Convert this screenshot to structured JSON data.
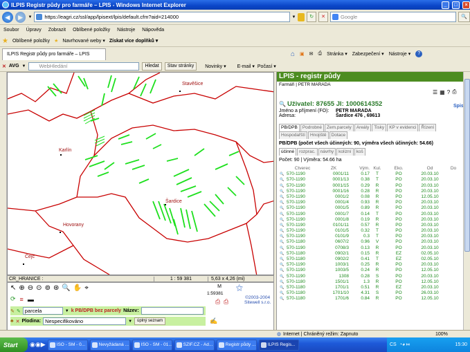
{
  "window": {
    "title": "ILPIS Registr půdy pro farmáře – LPIS - Windows Internet Explorer"
  },
  "address": {
    "url": "https://eagri.cz/ssl/app/lpisext/lpis/default.cfm?aid=214000",
    "search_placeholder": "Google"
  },
  "menu": [
    "Soubor",
    "Úpravy",
    "Zobrazit",
    "Oblíbené položky",
    "Nástroje",
    "Nápověda"
  ],
  "favbar": {
    "favorites": "Oblíbené položky",
    "suggested": "Navrhované weby ▾",
    "more": "Získat více doplňků ▾"
  },
  "tab": {
    "label": "ILPIS Registr půdy pro farmáře – LPIS"
  },
  "cmdbar": {
    "page": "Stránka ▾",
    "security": "Zabezpečení ▾",
    "tools": "Nástroje ▾"
  },
  "avg": {
    "label": "AVG",
    "search_placeholder": "WebHledání",
    "search_btn": "Hledat",
    "status_btn": "Stav stránky",
    "news": "Novinky ▾",
    "email": "E-mail ▾",
    "weather": "Počasí ▾"
  },
  "map": {
    "places": [
      "Stavěšice",
      "Karlín",
      "Šardice",
      "Hovorany",
      "Čejč"
    ],
    "label_left": "CR_HRANICE :",
    "scale": "1 : 59 381",
    "extent": "5,63 x 4,26 (mi)",
    "scale_small": "1:59381",
    "m_label": "M",
    "copyright1": "©2003-2004",
    "copyright2": "Sitewell s.r.o.",
    "layer_select": "parcela",
    "pb_label": "k PB/DPB bez parcely",
    "name_label": "Název:",
    "plodina_label": "Plodina:",
    "plodina_value": "Nespecifikováno",
    "full_list": "úplný seznam"
  },
  "panel": {
    "header": "LPIS - registr půdy",
    "sub": "Farmáři | PETR MARADA",
    "user": "Uživatel: 87655 JI: 1000614352",
    "spis": "Spis",
    "jmeno_label": "Jméno a příjmení (FO):",
    "jmeno": "PETR MARADA",
    "adresa_label": "Adresa:",
    "adresa": "Šardice 476 , 69613",
    "tabs1": [
      "PB/DPB",
      "Podrobné",
      "Zem.parcely",
      "Areály",
      "Tisky",
      "KP v evidenci",
      "Řízení"
    ],
    "tabs2": [
      "Hospodařští",
      "Hnojiště",
      "Dotace"
    ],
    "summary": "PB/DPB (počet všech účinných: 90, výměra všech účinných: 54.66)",
    "subtabs": [
      "účinné",
      "rozprac.",
      "návrhy",
      "kolizní",
      "koš"
    ],
    "count": "Počet: 90 | Výměra: 54.66 ha",
    "columns": [
      "Čtverec",
      "ZK",
      "Vým.",
      "Kul.",
      "Eko.",
      "Od",
      "Do"
    ],
    "rows": [
      [
        "570-1190",
        "0001/11",
        "0.17",
        "T",
        "PO",
        "20.03.10"
      ],
      [
        "570-1190",
        "0001/13",
        "0.38",
        "T",
        "PO",
        "20.03.10"
      ],
      [
        "570-1190",
        "0001/15",
        "0.29",
        "R",
        "PO",
        "20.03.10"
      ],
      [
        "570-1190",
        "0001/16",
        "0.28",
        "R",
        "PO",
        "20.03.10"
      ],
      [
        "570-1190",
        "0001/2",
        "0.08",
        "R",
        "PO",
        "12.05.10"
      ],
      [
        "570-1190",
        "0001/4",
        "0.93",
        "R",
        "PO",
        "20.03.10"
      ],
      [
        "570-1190",
        "0001/5",
        "0.89",
        "R",
        "PO",
        "20.03.10"
      ],
      [
        "570-1190",
        "0001/7",
        "0.14",
        "T",
        "PO",
        "20.03.10"
      ],
      [
        "570-1190",
        "0001/8",
        "0.19",
        "R",
        "PO",
        "20.03.10"
      ],
      [
        "570-1190",
        "0101/11",
        "0.57",
        "R",
        "PO",
        "20.03.10"
      ],
      [
        "570-1190",
        "0101/5",
        "0.32",
        "T",
        "PO",
        "20.03.10"
      ],
      [
        "570-1190",
        "0101/9",
        "0.3",
        "T",
        "PO",
        "20.03.10"
      ],
      [
        "570-1180",
        "0607/2",
        "0.96",
        "V",
        "PO",
        "20.03.10"
      ],
      [
        "570-1190",
        "0708/3",
        "0.13",
        "R",
        "PO",
        "20.03.10"
      ],
      [
        "570-1180",
        "0902/1",
        "0.15",
        "R",
        "EZ",
        "02.05.10"
      ],
      [
        "570-1180",
        "0902/2",
        "0.41",
        "T",
        "EZ",
        "02.05.10"
      ],
      [
        "570-1190",
        "1003/1",
        "0.25",
        "R",
        "PO",
        "20.03.10"
      ],
      [
        "570-1190",
        "1003/5",
        "0.24",
        "R",
        "PO",
        "12.05.10"
      ],
      [
        "570-1190",
        "1308",
        "0.28",
        "S",
        "PO",
        "20.03.10"
      ],
      [
        "570-1180",
        "1501/1",
        "1.3",
        "R",
        "PO",
        "12.05.10"
      ],
      [
        "570-1180",
        "1701/1",
        "0.51",
        "R",
        "EZ",
        "20.03.10"
      ],
      [
        "570-1180",
        "1701/10",
        "4.31",
        "S",
        "PO",
        "26.03.10"
      ],
      [
        "570-1180",
        "1701/6",
        "0.84",
        "R",
        "PO",
        "12.05.10"
      ]
    ]
  },
  "statusbar": {
    "zone": "Internet | Chráněný režim: Zapnuto",
    "zoom": "100%"
  },
  "taskbar": {
    "start": "Start",
    "tasks": [
      "ISO - SM - 0...",
      "Nevyžádaná ...",
      "ISO - SM - 01...",
      "SZIF.CZ - Ad...",
      "Registr půdy ...",
      "ILPIS Regis..."
    ],
    "lang": "CS",
    "clock": "15:30"
  },
  "colors": {
    "accent_green": "#4c8c20",
    "parcel_green": "#1ee01e",
    "boundary_red": "#c80000"
  }
}
